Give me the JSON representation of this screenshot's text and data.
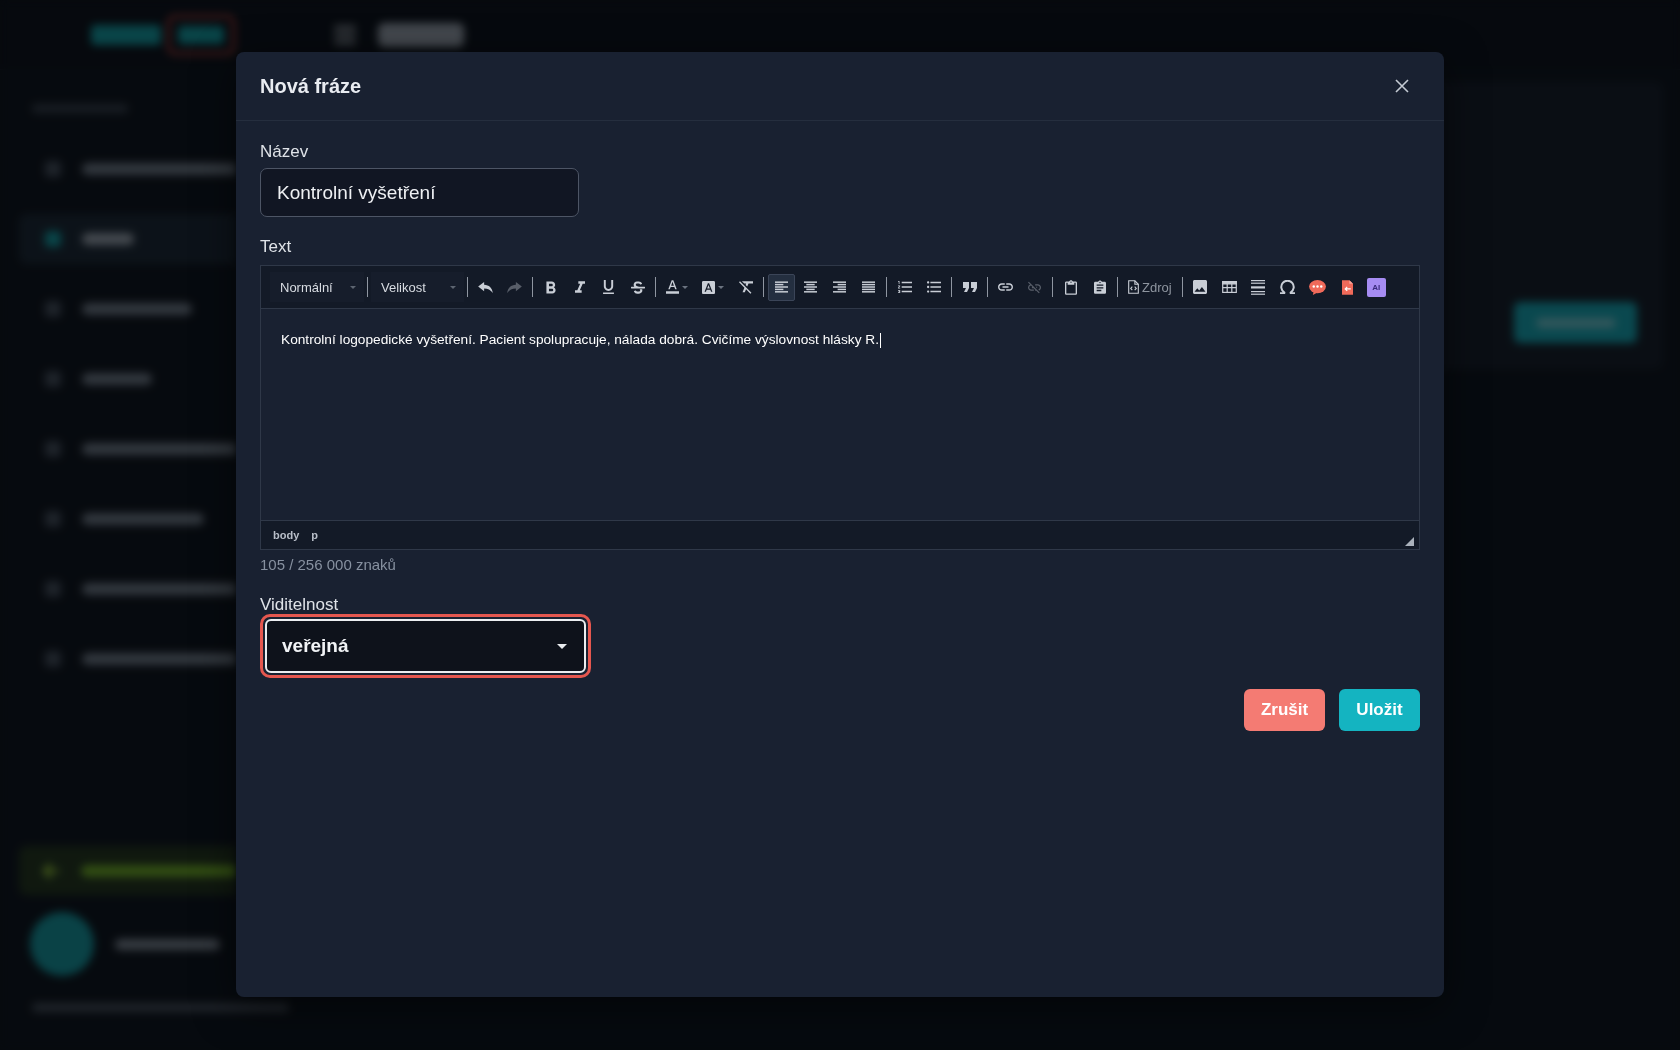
{
  "sidebar": {
    "items": [
      {
        "selected": false
      },
      {
        "selected": true
      },
      {
        "selected": false
      },
      {
        "selected": false
      },
      {
        "selected": false
      },
      {
        "selected": false
      },
      {
        "selected": false
      },
      {
        "selected": false
      }
    ]
  },
  "dialog": {
    "title": "Nová fráze",
    "name_field": {
      "label": "Název",
      "value": "Kontrolní vyšetření"
    },
    "text_field": {
      "label": "Text",
      "toolbar": {
        "combos": [
          {
            "label": "Normální"
          },
          {
            "label": "Velikost"
          }
        ],
        "groups": [
          [
            {
              "kind": "undo",
              "disabled": false,
              "selected": false
            },
            {
              "kind": "redo",
              "disabled": true,
              "selected": false
            }
          ],
          [
            {
              "kind": "bold",
              "disabled": false,
              "selected": false
            },
            {
              "kind": "italic",
              "disabled": false,
              "selected": false
            },
            {
              "kind": "underline",
              "disabled": false,
              "selected": false
            },
            {
              "kind": "strike",
              "disabled": false,
              "selected": false
            }
          ],
          [
            {
              "kind": "textcolor",
              "disabled": false,
              "selected": false
            },
            {
              "kind": "bgcolor",
              "disabled": false,
              "selected": false
            },
            {
              "kind": "clearformat",
              "disabled": false,
              "selected": false
            }
          ],
          [
            {
              "kind": "alignleft",
              "disabled": false,
              "selected": true
            },
            {
              "kind": "aligncenter",
              "disabled": false,
              "selected": false
            },
            {
              "kind": "alignright",
              "disabled": false,
              "selected": false
            },
            {
              "kind": "justify",
              "disabled": false,
              "selected": false
            }
          ],
          [
            {
              "kind": "numbered",
              "disabled": false,
              "selected": false
            },
            {
              "kind": "bulleted",
              "disabled": false,
              "selected": false
            }
          ],
          [
            {
              "kind": "quote",
              "disabled": false,
              "selected": false
            }
          ],
          [
            {
              "kind": "link",
              "disabled": false,
              "selected": false
            },
            {
              "kind": "unlink",
              "disabled": true,
              "selected": false
            }
          ],
          [
            {
              "kind": "pastetext",
              "disabled": false,
              "selected": false
            },
            {
              "kind": "pasteword",
              "disabled": false,
              "selected": false
            }
          ],
          [
            {
              "kind": "source",
              "label": "Zdroj",
              "disabled": false,
              "selected": false
            }
          ],
          [
            {
              "kind": "image",
              "disabled": false,
              "selected": false
            },
            {
              "kind": "table",
              "disabled": false,
              "selected": false
            },
            {
              "kind": "rule",
              "disabled": false,
              "selected": false
            },
            {
              "kind": "omega",
              "disabled": false,
              "selected": false
            },
            {
              "kind": "comment",
              "disabled": false,
              "selected": false
            },
            {
              "kind": "import",
              "disabled": false,
              "selected": false
            },
            {
              "kind": "ai",
              "label": "AI",
              "disabled": false,
              "selected": false
            }
          ]
        ]
      },
      "content": "Kontrolní logopedické vyšetření. Pacient spolupracuje, nálada dobrá. Cvičíme výslovnost hlásky R.",
      "path": [
        "body",
        "p"
      ],
      "counter": "105 / 256 000 znaků"
    },
    "visibility_field": {
      "label": "Viditelnost",
      "value": "veřejná",
      "focused": true
    },
    "buttons": [
      {
        "label": "Zrušit",
        "kind": "cancel"
      },
      {
        "label": "Uložit",
        "kind": "save"
      }
    ]
  }
}
